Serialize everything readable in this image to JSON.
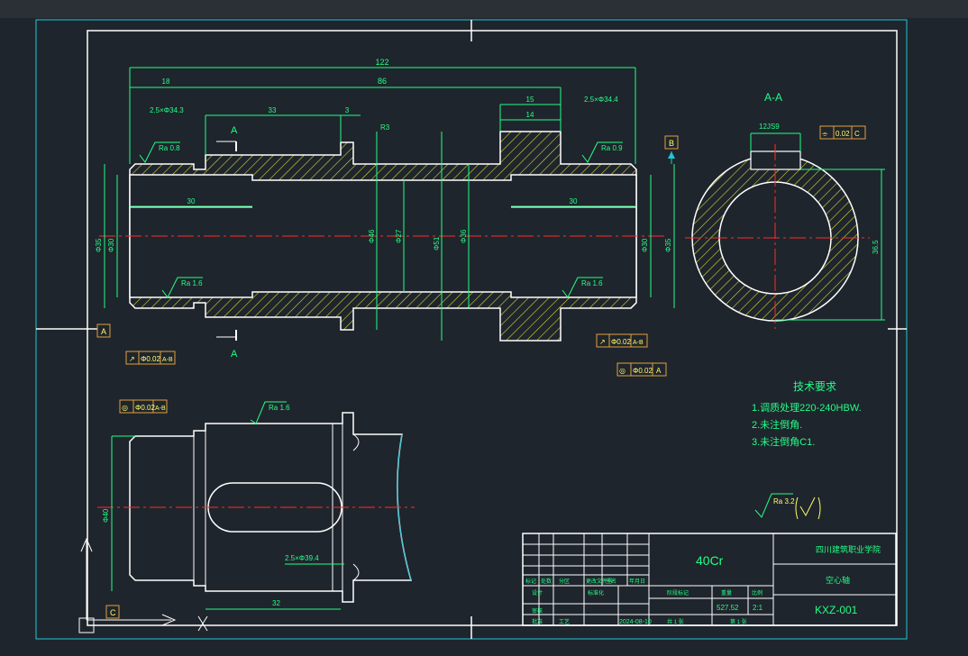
{
  "colors": {
    "background": "#1f252c",
    "frame": "#ffffff",
    "border": "#22c6d8",
    "dimension": "#22ff88",
    "hatch": "#d6d633",
    "centerline": "#ff2a2a",
    "text_yellow": "#ffff66",
    "tolerance_box": "#e0a040"
  },
  "top_view": {
    "dims": {
      "overall": "122",
      "left_end": "18",
      "middle": "86",
      "groove_left": "2.5×Φ34.3",
      "len_33": "33",
      "len_3": "3",
      "len_15": "15",
      "len_14": "14",
      "groove_right": "2.5×Φ34.4",
      "bore_left": "30",
      "bore_right": "30",
      "radius": "R3",
      "dia_46": "Φ46",
      "dia_27": "Φ27",
      "dia_51": "Φ51",
      "dia_36": "Φ36",
      "dia_left_1": "Φ35",
      "dia_left_2": "Φ30",
      "dia_right_1": "Φ30",
      "dia_right_2": "Φ35"
    },
    "roughness": [
      "Ra 0.8",
      "Ra 0.9",
      "Ra 1.6",
      "Ra 1.6"
    ],
    "section_mark": "A",
    "datum_a": "A",
    "datum_b": "B",
    "tol1": [
      "↗",
      "Φ0.02",
      "A-B"
    ],
    "tol2": [
      "↗",
      "Φ0.02",
      "A-B"
    ],
    "tol3": [
      "◎",
      "Φ0.02",
      "A"
    ]
  },
  "section_view": {
    "title": "A-A",
    "keyway": "12JS9",
    "depth": "36.5",
    "tol": [
      "⌯",
      "0.02",
      "C"
    ]
  },
  "tech_req": {
    "title": "技术要求",
    "items": [
      "1.调质处理220-240HBW.",
      "2.未注倒角.",
      "3.未注倒角C1."
    ]
  },
  "lower_view": {
    "tol": [
      "◎",
      "Φ0.02",
      "A-B"
    ],
    "roughness": "Ra 1.6",
    "keyway_dim": "2.5×Φ39.4",
    "len": "32",
    "dia": "Φ40",
    "datum_c": "C"
  },
  "roughness_general": "Ra 3.2",
  "title_block": {
    "material": "40Cr",
    "school": "四川建筑职业学院",
    "part_name": "空心轴",
    "drawing_no": "KXZ-001",
    "weight": "527.52",
    "scale": "2:1",
    "date": "2024-08-10",
    "labels": [
      "标记",
      "处数",
      "分区",
      "更改文件号",
      "签名",
      "年月日",
      "设计",
      "标准化",
      "阶段标记",
      "重量",
      "比例",
      "审核",
      "工艺",
      "批准",
      "共 1 张",
      "第 1 张"
    ]
  }
}
